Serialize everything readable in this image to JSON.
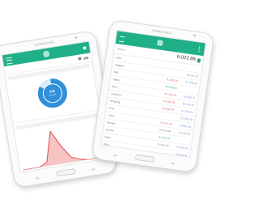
{
  "device": {
    "brand": "SAMSUNG"
  },
  "left": {
    "count": "101",
    "donut": {
      "value": "536",
      "sub": "91.6%",
      "fraction": 0.85,
      "color": "#2f8fd8",
      "track": "#d6ecf8"
    },
    "chart": {
      "series": [
        0,
        0,
        0,
        0.1,
        0.95,
        0.5,
        0.15,
        0.05,
        0,
        0,
        0
      ],
      "color": "#e24a4a",
      "fill": "#f7c4c4"
    }
  },
  "right": {
    "balance": "6,022.86",
    "tag": "Balance",
    "rows": [
      {
        "label": "Date",
        "amount": "",
        "amount2": "",
        "tone": "gray"
      },
      {
        "label": "Category",
        "amount": "",
        "amount2": "$ 2,011.10",
        "tone": "red"
      },
      {
        "label": "Bills",
        "amount": "$ 1,203.32",
        "amount2": "$ 4,820.28",
        "tone": "red"
      },
      {
        "label": "Salary",
        "amount": "$ 8,226.34",
        "amount2": "",
        "tone": "green"
      },
      {
        "label": "Rent",
        "amount": "$ 1,501.88",
        "amount2": "$ 4,301.24",
        "tone": "red"
      },
      {
        "label": "Transport",
        "amount": "$ 2,001.90",
        "amount2": "$ 3,201.62",
        "tone": "red"
      },
      {
        "label": "Shopping",
        "amount": "$ 1,001.00",
        "amount2": "$ 2,201.62",
        "tone": "red"
      },
      {
        "label": "Food",
        "amount": "",
        "amount2": "$ 1,991.00",
        "tone": "gray"
      },
      {
        "label": "Travel",
        "amount": "$ 2,011.10",
        "amount2": "$ 2,011.10",
        "tone": "red"
      },
      {
        "label": "Savings",
        "amount": "$ 3,001.00",
        "amount2": "$ 4,210.00",
        "tone": "gray"
      },
      {
        "label": "Income",
        "amount": "$ 2,011.10",
        "amount2": "",
        "tone": "green"
      },
      {
        "label": "Other",
        "amount": "$ 1,001.00",
        "amount2": "$ 1,031.00",
        "tone": "gray"
      },
      {
        "label": "Total",
        "amount": "",
        "amount2": "$ 6,022.86",
        "tone": "gray"
      },
      {
        "label": "",
        "amount": "",
        "amount2": "",
        "tone": "gray"
      },
      {
        "label": "",
        "amount": "",
        "amount2": "",
        "tone": "gray"
      }
    ]
  }
}
